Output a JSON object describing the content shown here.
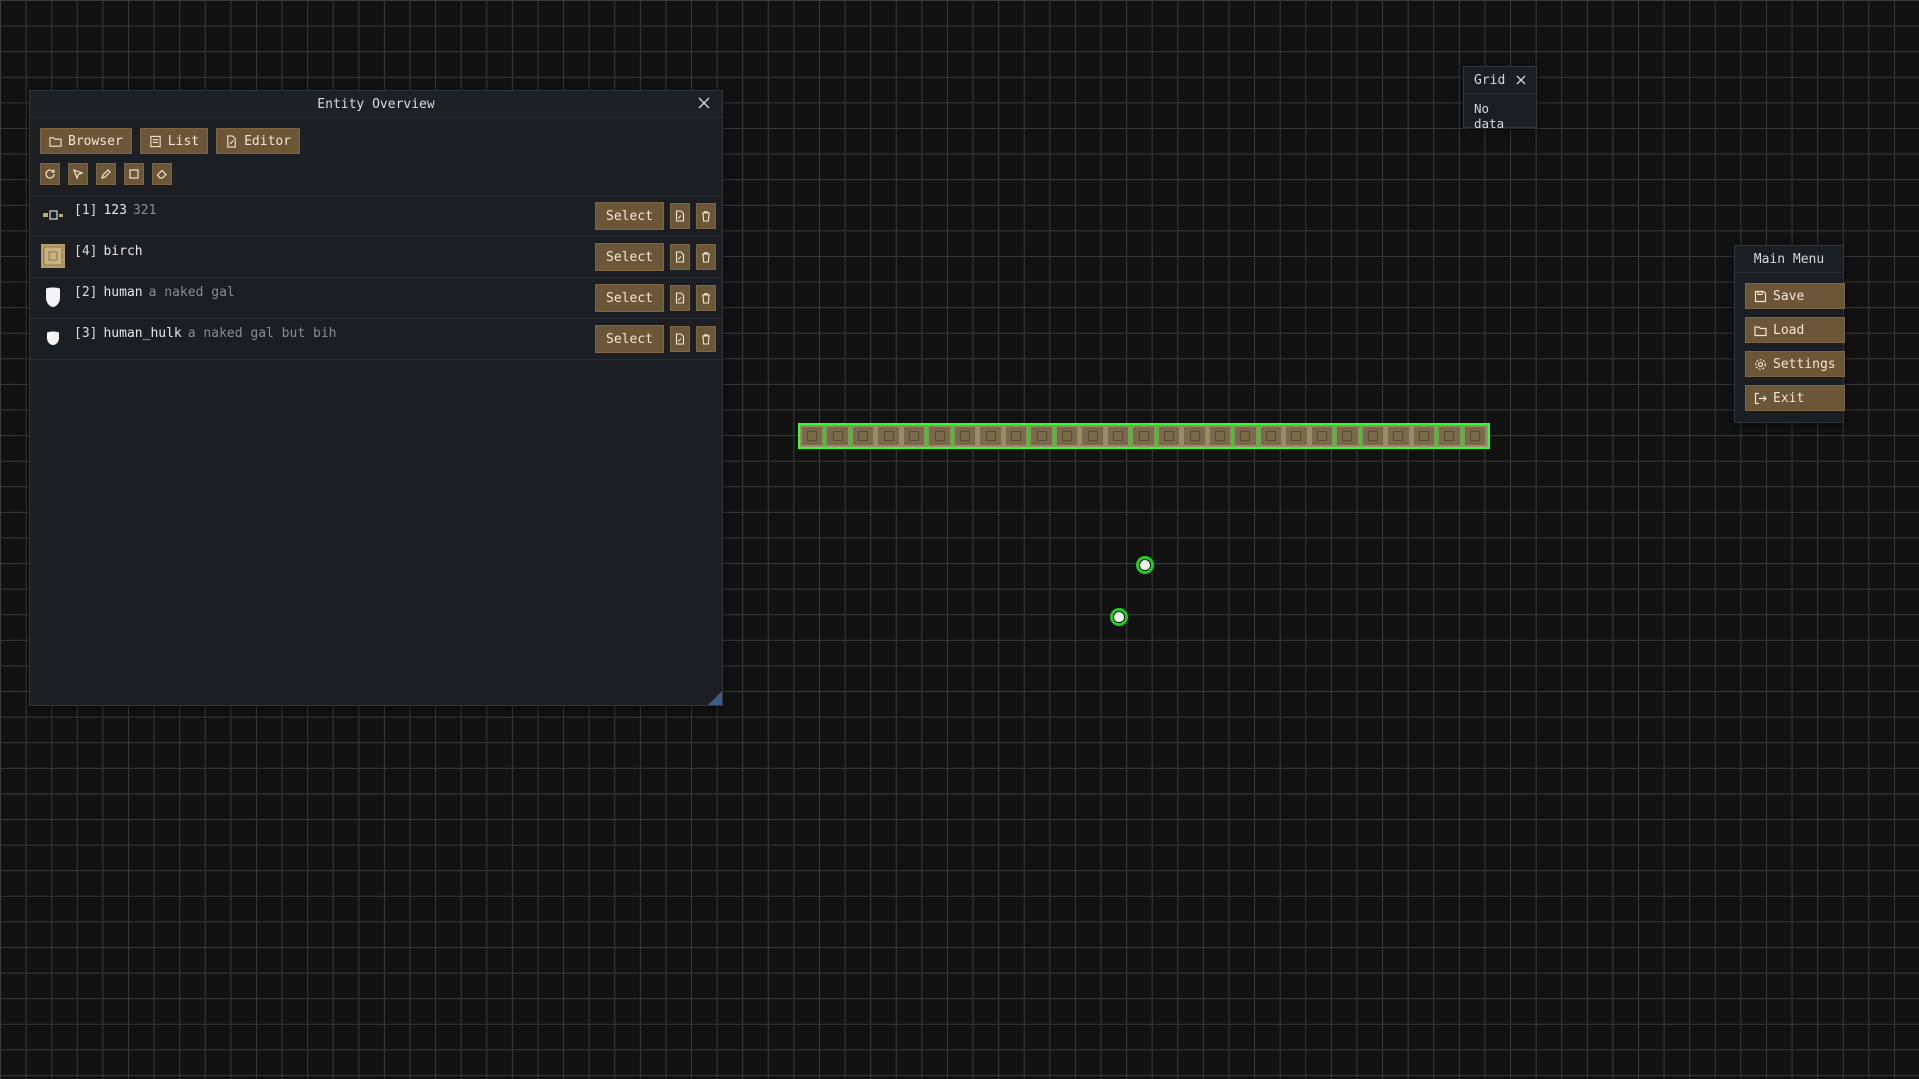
{
  "entity_overview": {
    "title": "Entity Overview",
    "tabs": [
      {
        "label": "Browser",
        "icon": "folder-icon"
      },
      {
        "label": "List",
        "icon": "list-icon"
      },
      {
        "label": "Editor",
        "icon": "edit-document-icon"
      }
    ],
    "tools": [
      "refresh-icon",
      "pointer-icon",
      "pen-icon",
      "rectangle-icon",
      "eraser-icon"
    ],
    "rows": [
      {
        "index": "[1]",
        "name": "123",
        "desc": "321",
        "thumb": "small-sprite",
        "select_label": "Select"
      },
      {
        "index": "[4]",
        "name": "birch",
        "desc": "",
        "thumb": "wood-tile",
        "select_label": "Select"
      },
      {
        "index": "[2]",
        "name": "human",
        "desc": "a naked gal",
        "thumb": "white-head",
        "select_label": "Select"
      },
      {
        "index": "[3]",
        "name": "human_hulk",
        "desc": "a naked gal but bih",
        "thumb": "white-head-small",
        "select_label": "Select"
      }
    ]
  },
  "grid_panel": {
    "title": "Grid",
    "body": "No data"
  },
  "main_menu": {
    "title": "Main Menu",
    "items": [
      {
        "label": "Save",
        "icon": "save-icon"
      },
      {
        "label": "Load",
        "icon": "folder-open-icon"
      },
      {
        "label": "Settings",
        "icon": "gear-icon"
      },
      {
        "label": "Exit",
        "icon": "exit-icon"
      }
    ]
  },
  "colors": {
    "accent_button": "#6b5638",
    "selection_green": "#33ff33",
    "grid_line": "#3a3a3a"
  }
}
